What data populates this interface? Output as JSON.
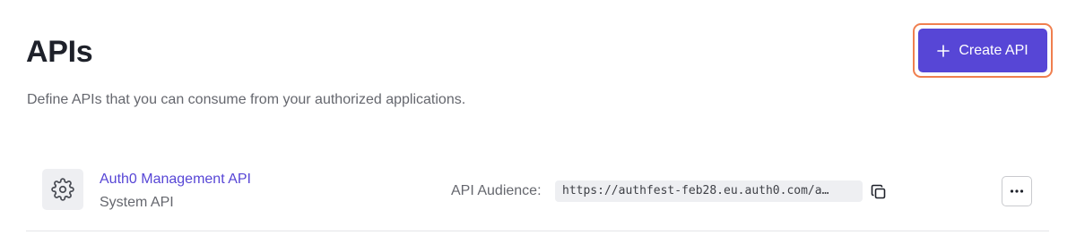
{
  "header": {
    "title": "APIs",
    "description": "Define APIs that you can consume from your authorized applications.",
    "create_button_label": "Create API",
    "create_button_icon": "plus-icon"
  },
  "apis": [
    {
      "name": "Auth0 Management API",
      "type": "System API",
      "icon": "gear-icon",
      "audience_label": "API Audience:",
      "audience_value": "https://authfest-feb28.eu.auth0.com/a…",
      "copy_icon": "copy-icon",
      "more_icon": "more-options-icon"
    }
  ],
  "colors": {
    "accent": "#5746d6",
    "highlight_outline": "#f07f4f",
    "muted_text": "#65676e",
    "title_text": "#1e212a"
  }
}
